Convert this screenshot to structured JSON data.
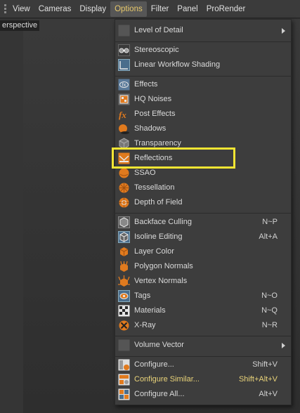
{
  "menubar": {
    "items": [
      "View",
      "Cameras",
      "Display",
      "Options",
      "Filter",
      "Panel",
      "ProRender"
    ],
    "active_index": 3
  },
  "viewport": {
    "label": "erspective"
  },
  "dropdown": {
    "groups": [
      [
        {
          "label": "Level of Detail",
          "icon": "blank-icon",
          "submenu": true
        }
      ],
      [
        {
          "label": "Stereoscopic",
          "icon": "stereoscopic-icon"
        },
        {
          "label": "Linear Workflow Shading",
          "icon": "linear-workflow-icon"
        }
      ],
      [
        {
          "label": "Effects",
          "icon": "effects-icon"
        },
        {
          "label": "HQ Noises",
          "icon": "hq-noises-icon"
        },
        {
          "label": "Post Effects",
          "icon": "post-effects-icon"
        },
        {
          "label": "Shadows",
          "icon": "shadows-icon"
        },
        {
          "label": "Transparency",
          "icon": "transparency-icon"
        },
        {
          "label": "Reflections",
          "icon": "reflections-icon"
        },
        {
          "label": "SSAO",
          "icon": "ssao-icon"
        },
        {
          "label": "Tessellation",
          "icon": "tessellation-icon"
        },
        {
          "label": "Depth of Field",
          "icon": "depth-of-field-icon"
        }
      ],
      [
        {
          "label": "Backface Culling",
          "icon": "backface-culling-icon",
          "shortcut": "N~P"
        },
        {
          "label": "Isoline Editing",
          "icon": "isoline-editing-icon",
          "shortcut": "Alt+A"
        },
        {
          "label": "Layer Color",
          "icon": "layer-color-icon"
        },
        {
          "label": "Polygon Normals",
          "icon": "polygon-normals-icon"
        },
        {
          "label": "Vertex Normals",
          "icon": "vertex-normals-icon"
        },
        {
          "label": "Tags",
          "icon": "tags-icon",
          "shortcut": "N~O"
        },
        {
          "label": "Materials",
          "icon": "materials-icon",
          "shortcut": "N~Q"
        },
        {
          "label": "X-Ray",
          "icon": "x-ray-icon",
          "shortcut": "N~R"
        }
      ],
      [
        {
          "label": "Volume Vector",
          "icon": "blank-icon",
          "submenu": true
        }
      ],
      [
        {
          "label": "Configure...",
          "icon": "configure-icon",
          "shortcut": "Shift+V"
        },
        {
          "label": "Configure Similar...",
          "icon": "configure-similar-icon",
          "shortcut": "Shift+Alt+V",
          "highlight": true
        },
        {
          "label": "Configure All...",
          "icon": "configure-all-icon",
          "shortcut": "Alt+V"
        }
      ]
    ]
  },
  "annotation": {
    "target": "Reflections",
    "color": "#f2e533"
  },
  "colors": {
    "menu_bg": "#3d3d3d",
    "active_menu_text": "#e8c96b",
    "accent_orange": "#e07a1e",
    "highlight_text": "#ead47a"
  }
}
